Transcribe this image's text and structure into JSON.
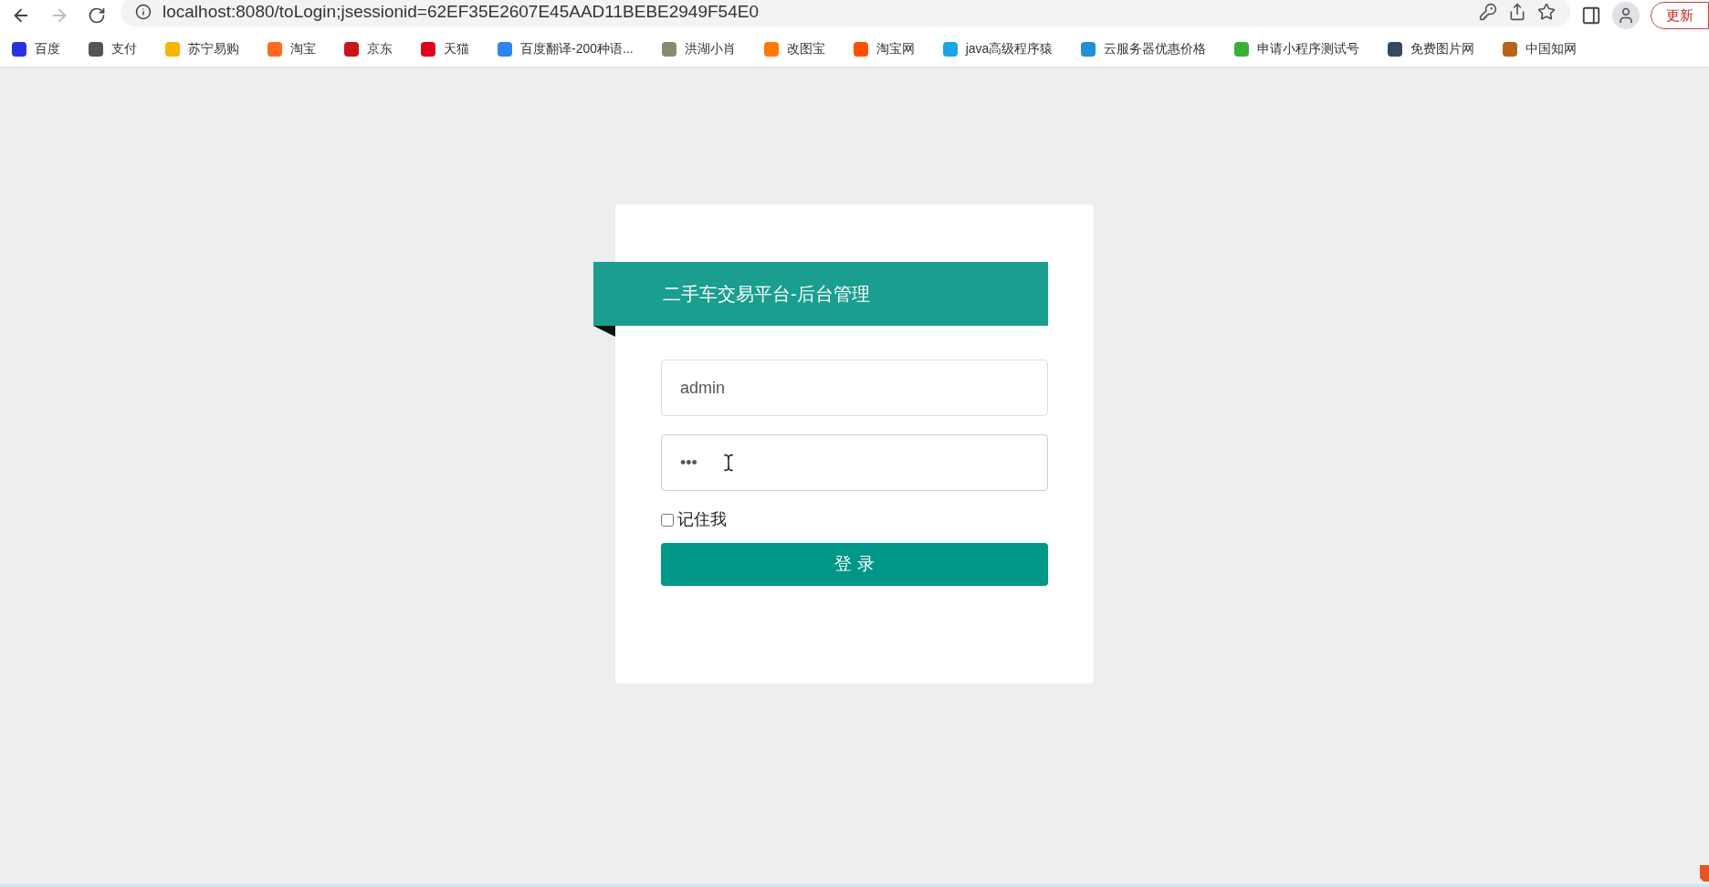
{
  "browser": {
    "back_enabled": true,
    "forward_enabled": false,
    "address": "localhost:8080/toLogin;jsessionid=62EF35E2607E45AAD11BEBE2949F54E0",
    "update_button": "更新"
  },
  "bookmarks": [
    {
      "label": "百度",
      "color": "#2932e1"
    },
    {
      "label": "支付",
      "color": "#555555"
    },
    {
      "label": "苏宁易购",
      "color": "#f5b400"
    },
    {
      "label": "淘宝",
      "color": "#ff6a1f"
    },
    {
      "label": "京东",
      "color": "#c8161d"
    },
    {
      "label": "天猫",
      "color": "#e0001b"
    },
    {
      "label": "百度翻译-200种语...",
      "color": "#2f84f0"
    },
    {
      "label": "洪湖小肖",
      "color": "#8a8a70"
    },
    {
      "label": "改图宝",
      "color": "#ff7a00"
    },
    {
      "label": "淘宝网",
      "color": "#ff5000"
    },
    {
      "label": "java高级程序猿",
      "color": "#18a7e0"
    },
    {
      "label": "云服务器优惠价格",
      "color": "#1e90d6"
    },
    {
      "label": "申请小程序测试号",
      "color": "#3cb034"
    },
    {
      "label": "免费图片网",
      "color": "#34495e"
    },
    {
      "label": "中国知网",
      "color": "#b5651d"
    }
  ],
  "login": {
    "title": "二手车交易平台-后台管理",
    "username": {
      "value": "admin"
    },
    "password": {
      "masked": "•••"
    },
    "remember": {
      "label": "记住我",
      "checked": false
    },
    "submit": "登 录"
  }
}
